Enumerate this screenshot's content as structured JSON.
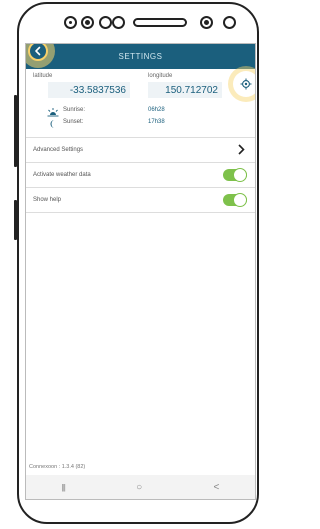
{
  "header": {
    "title": "SETTINGS"
  },
  "location": {
    "latitude_label": "latitude",
    "latitude_value": "-33.5837536",
    "longitude_label": "longitude",
    "longitude_value": "150.712702"
  },
  "sun": {
    "sunrise_label": "Sunrise:",
    "sunrise_value": "06h28",
    "sunset_label": "Sunset:",
    "sunset_value": "17h38"
  },
  "settings": {
    "advanced_label": "Advanced Settings",
    "weather_label": "Activate weather data",
    "weather_enabled": true,
    "help_label": "Show help",
    "help_enabled": true
  },
  "footer": {
    "version": "Connexoon : 1.3.4 (82)"
  },
  "nav": {
    "recents": "|||",
    "home": "○",
    "back": "<"
  },
  "colors": {
    "header": "#1b5f7d",
    "toggle_on": "#7ec14b",
    "highlight": "#f7d369"
  },
  "icons": [
    "back-arrow-icon",
    "locate-icon",
    "sunrise-icon",
    "moon-icon",
    "chevron-right-icon"
  ]
}
